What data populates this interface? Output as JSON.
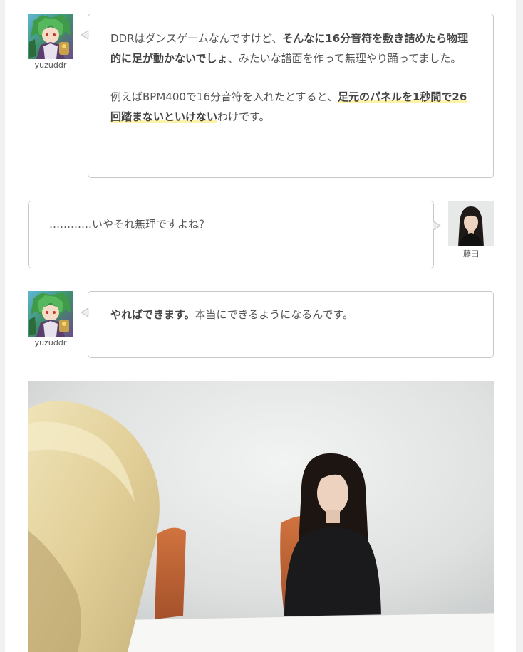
{
  "messages": [
    {
      "speaker": "yuzuddr",
      "avatar_icon": "yuzuddr-avatar-icon",
      "side": "left",
      "paragraph1": {
        "part1": "DDRはダンスゲームなんですけど、",
        "bold1": "そんなに16分音符を敷き詰めたら物理的に足が動かないでしょ",
        "part2": "、みたいな譜面を作って無理やり踊ってました。"
      },
      "paragraph2": {
        "part1": "例えばBPM400で16分音符を入れたとすると、",
        "marker1": "足元のパネルを1秒間で26回踏まないといけない",
        "part2": "わけです。"
      }
    },
    {
      "speaker": "藤田",
      "avatar_icon": "fujita-avatar-icon",
      "side": "right",
      "text": "…………いやそれ無理ですよね？"
    },
    {
      "speaker": "yuzuddr",
      "avatar_icon": "yuzuddr-avatar-icon",
      "side": "left",
      "bold1": "やればできます。",
      "part1": "本当にできるようになるんです。"
    }
  ],
  "photo": {
    "icon": "interview-photo"
  },
  "colors": {
    "bubble_border": "#c8c8c8",
    "text": "#555555",
    "marker": "#fdf2a8",
    "page_bg": "#f1f1f1"
  }
}
